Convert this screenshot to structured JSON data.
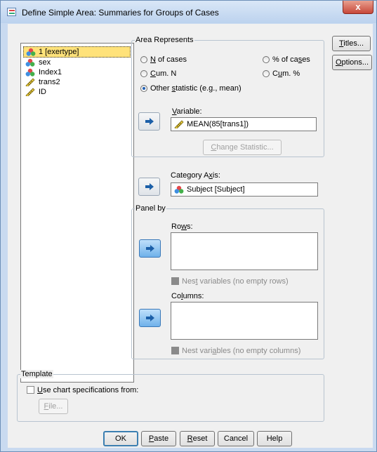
{
  "window": {
    "title": "Define Simple Area: Summaries for Groups of Cases",
    "close_label": "x"
  },
  "variables": [
    {
      "label": "1 [exertype]",
      "icon": "nominal-icon",
      "selected": true
    },
    {
      "label": "sex",
      "icon": "nominal-icon",
      "selected": false
    },
    {
      "label": "Index1",
      "icon": "nominal-icon",
      "selected": false
    },
    {
      "label": "trans2",
      "icon": "scale-icon",
      "selected": false
    },
    {
      "label": "ID",
      "icon": "scale-icon",
      "selected": false
    }
  ],
  "area_represents": {
    "legend": "Area Represents",
    "options": [
      {
        "pre": "",
        "u": "N",
        "post": " of cases",
        "checked": false
      },
      {
        "pre": "% of ca",
        "u": "s",
        "post": "es",
        "checked": false
      },
      {
        "pre": "",
        "u": "C",
        "post": "um. N",
        "checked": false
      },
      {
        "pre": "C",
        "u": "u",
        "post": "m. %",
        "checked": false
      },
      {
        "pre": "Other ",
        "u": "s",
        "post": "tatistic (e.g., mean)",
        "checked": true
      }
    ],
    "variable_label_u": "V",
    "variable_label_rest": "ariable:",
    "variable_value": "MEAN(85[trans1])",
    "change_statistic_pre": "",
    "change_statistic_u": "C",
    "change_statistic_post": "hange Statistic..."
  },
  "category_axis": {
    "label_pre": "Category A",
    "label_u": "x",
    "label_post": "is:",
    "value": "Subject [Subject]"
  },
  "panel_by": {
    "legend": "Panel by",
    "rows_pre": "Ro",
    "rows_u": "w",
    "rows_post": "s:",
    "nest_rows_pre": "Nes",
    "nest_rows_u": "t",
    "nest_rows_post": " variables (no empty rows)",
    "columns_pre": "Co",
    "columns_u": "l",
    "columns_post": "umns:",
    "nest_cols_pre": "Nest vari",
    "nest_cols_u": "a",
    "nest_cols_post": "bles (no empty columns)"
  },
  "template": {
    "legend": "Template",
    "use_spec_u": "U",
    "use_spec_rest": "se chart specifications from:",
    "file_u": "F",
    "file_rest": "ile..."
  },
  "side_buttons": {
    "titles_u": "T",
    "titles_rest": "itles...",
    "options_u": "O",
    "options_rest": "ptions..."
  },
  "bottom_buttons": {
    "ok": "OK",
    "paste_u": "P",
    "paste_rest": "aste",
    "reset_u": "R",
    "reset_rest": "eset",
    "cancel": "Cancel",
    "help": "Help"
  },
  "colors": {
    "accent": "#3c7fb1",
    "selected_item": "#ffe27a",
    "title_bar": "#bcd2ee",
    "close_button": "#c7483a"
  }
}
